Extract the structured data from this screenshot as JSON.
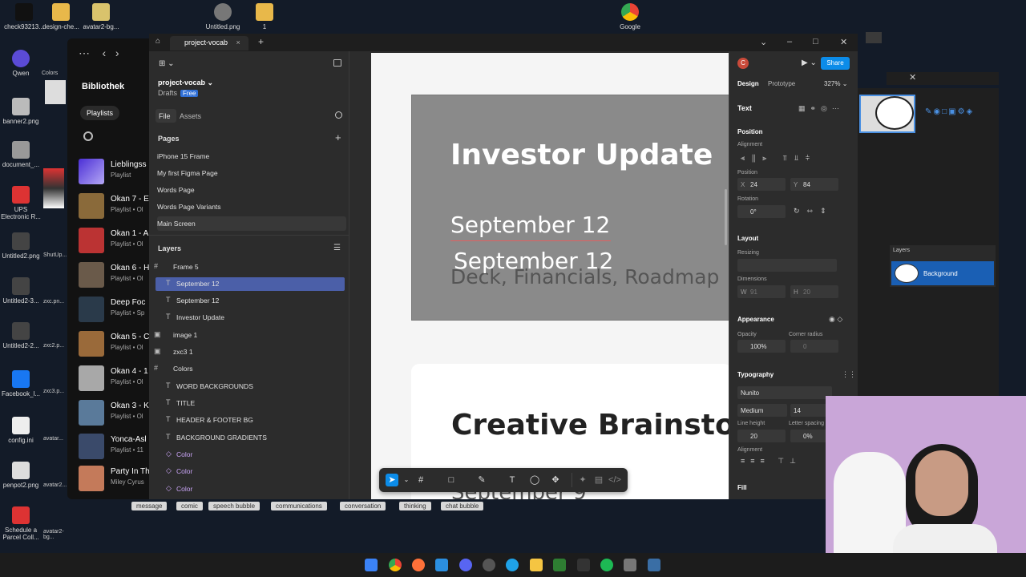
{
  "desktop": {
    "top_icons": [
      "check93213...",
      "design-che...",
      "avatar2-bg...",
      "Untitled.png",
      "1",
      "Google"
    ],
    "left_icons": [
      "Qwen",
      "banner2.png",
      "document_...",
      "UPS Electronic R...",
      "Untitled2.png",
      "Untitled2-3...",
      "Untitled2-2...",
      "Facebook_l...",
      "config.ini",
      "penpot2.png",
      "Schedule a Parcel Coll..."
    ],
    "second_col_icons": [
      "Colors",
      "ShutUp...",
      "zxc.pn...",
      "zxc2.p...",
      "zxc3.p...",
      "avatar...",
      "avatar2...",
      "avatar2-bg..."
    ]
  },
  "spotify": {
    "library_title": "Bibliothek",
    "playlists_pill": "Playlists",
    "items": [
      {
        "title": "Lieblingss",
        "sub": "Playlist"
      },
      {
        "title": "Okan 7 - E",
        "sub": "Playlist • Ol"
      },
      {
        "title": "Okan 1 - A",
        "sub": "Playlist • Ol"
      },
      {
        "title": "Okan 6 - H",
        "sub": "Playlist • Ol"
      },
      {
        "title": "Deep Foc",
        "sub": "Playlist • Sp"
      },
      {
        "title": "Okan 5 - C",
        "sub": "Playlist • Ol"
      },
      {
        "title": "Okan 4 - 1",
        "sub": "Playlist • Ol"
      },
      {
        "title": "Okan 3 - K",
        "sub": "Playlist • Ol"
      },
      {
        "title": "Yonca-Asl",
        "sub": "Playlist • 11"
      },
      {
        "title": "Party In Th",
        "sub": "Miley Cyrus"
      }
    ]
  },
  "figma": {
    "tab_title": "project-vocab",
    "project_name": "project-vocab",
    "drafts": "Drafts",
    "free_badge": "Free",
    "file_tab": "File",
    "assets_tab": "Assets",
    "pages_label": "Pages",
    "pages": [
      "iPhone 15 Frame",
      "My first Figma Page",
      "Words Page",
      "Words Page Variants",
      "Main Screen"
    ],
    "layers_label": "Layers",
    "layers": [
      {
        "name": "Frame 5",
        "icon": "#"
      },
      {
        "name": "September 12",
        "icon": "T"
      },
      {
        "name": "September 12",
        "icon": "T"
      },
      {
        "name": "Investor Update",
        "icon": "T"
      },
      {
        "name": "image 1",
        "icon": "▣"
      },
      {
        "name": "zxc3 1",
        "icon": "▣"
      },
      {
        "name": "Colors",
        "icon": "#"
      },
      {
        "name": "WORD BACKGROUNDS",
        "icon": "T"
      },
      {
        "name": "TITLE",
        "icon": "T"
      },
      {
        "name": "HEADER & FOOTER BG",
        "icon": "T"
      },
      {
        "name": "BACKGROUND GRADIENTS",
        "icon": "T"
      },
      {
        "name": "Color",
        "icon": "◇"
      },
      {
        "name": "Color",
        "icon": "◇"
      },
      {
        "name": "Color",
        "icon": "◇"
      }
    ],
    "canvas": {
      "title1": "Investor Update",
      "date1": "September 12",
      "date2": "September 12",
      "subtitle": "Deck, Financials, Roadmap",
      "title2": "Creative Brainstorm",
      "footer_partial": "September 9"
    },
    "right": {
      "avatar_letter": "C",
      "share": "Share",
      "design_tab": "Design",
      "prototype_tab": "Prototype",
      "zoom": "327%",
      "section_text": "Text",
      "position": "Position",
      "alignment": "Alignment",
      "position_sub": "Position",
      "x_label": "X",
      "x_value": "24",
      "y_label": "Y",
      "y_value": "84",
      "rotation": "Rotation",
      "rotation_value": "0°",
      "layout": "Layout",
      "resizing": "Resizing",
      "dimensions": "Dimensions",
      "w_label": "W",
      "w_value": "91",
      "h_label": "H",
      "h_value": "20",
      "appearance": "Appearance",
      "opacity": "Opacity",
      "opacity_value": "100%",
      "corner_radius": "Corner radius",
      "corner_value": "0",
      "typography": "Typography",
      "font": "Nunito",
      "weight": "Medium",
      "size": "14",
      "line_height": "Line height",
      "line_height_value": "20",
      "letter_spacing": "Letter spacing",
      "letter_spacing_value": "0%",
      "alignment2": "Alignment",
      "fill": "Fill"
    }
  },
  "bg_app": {
    "layers": "Layers",
    "background": "Background"
  },
  "tags": [
    "message",
    "comic",
    "speech bubble",
    "communications",
    "conversation",
    "thinking",
    "chat bubble"
  ],
  "colors": {
    "accent": "#0c8ce9",
    "selected_layer": "#4b5fa8",
    "share": "#0c8ce9"
  }
}
